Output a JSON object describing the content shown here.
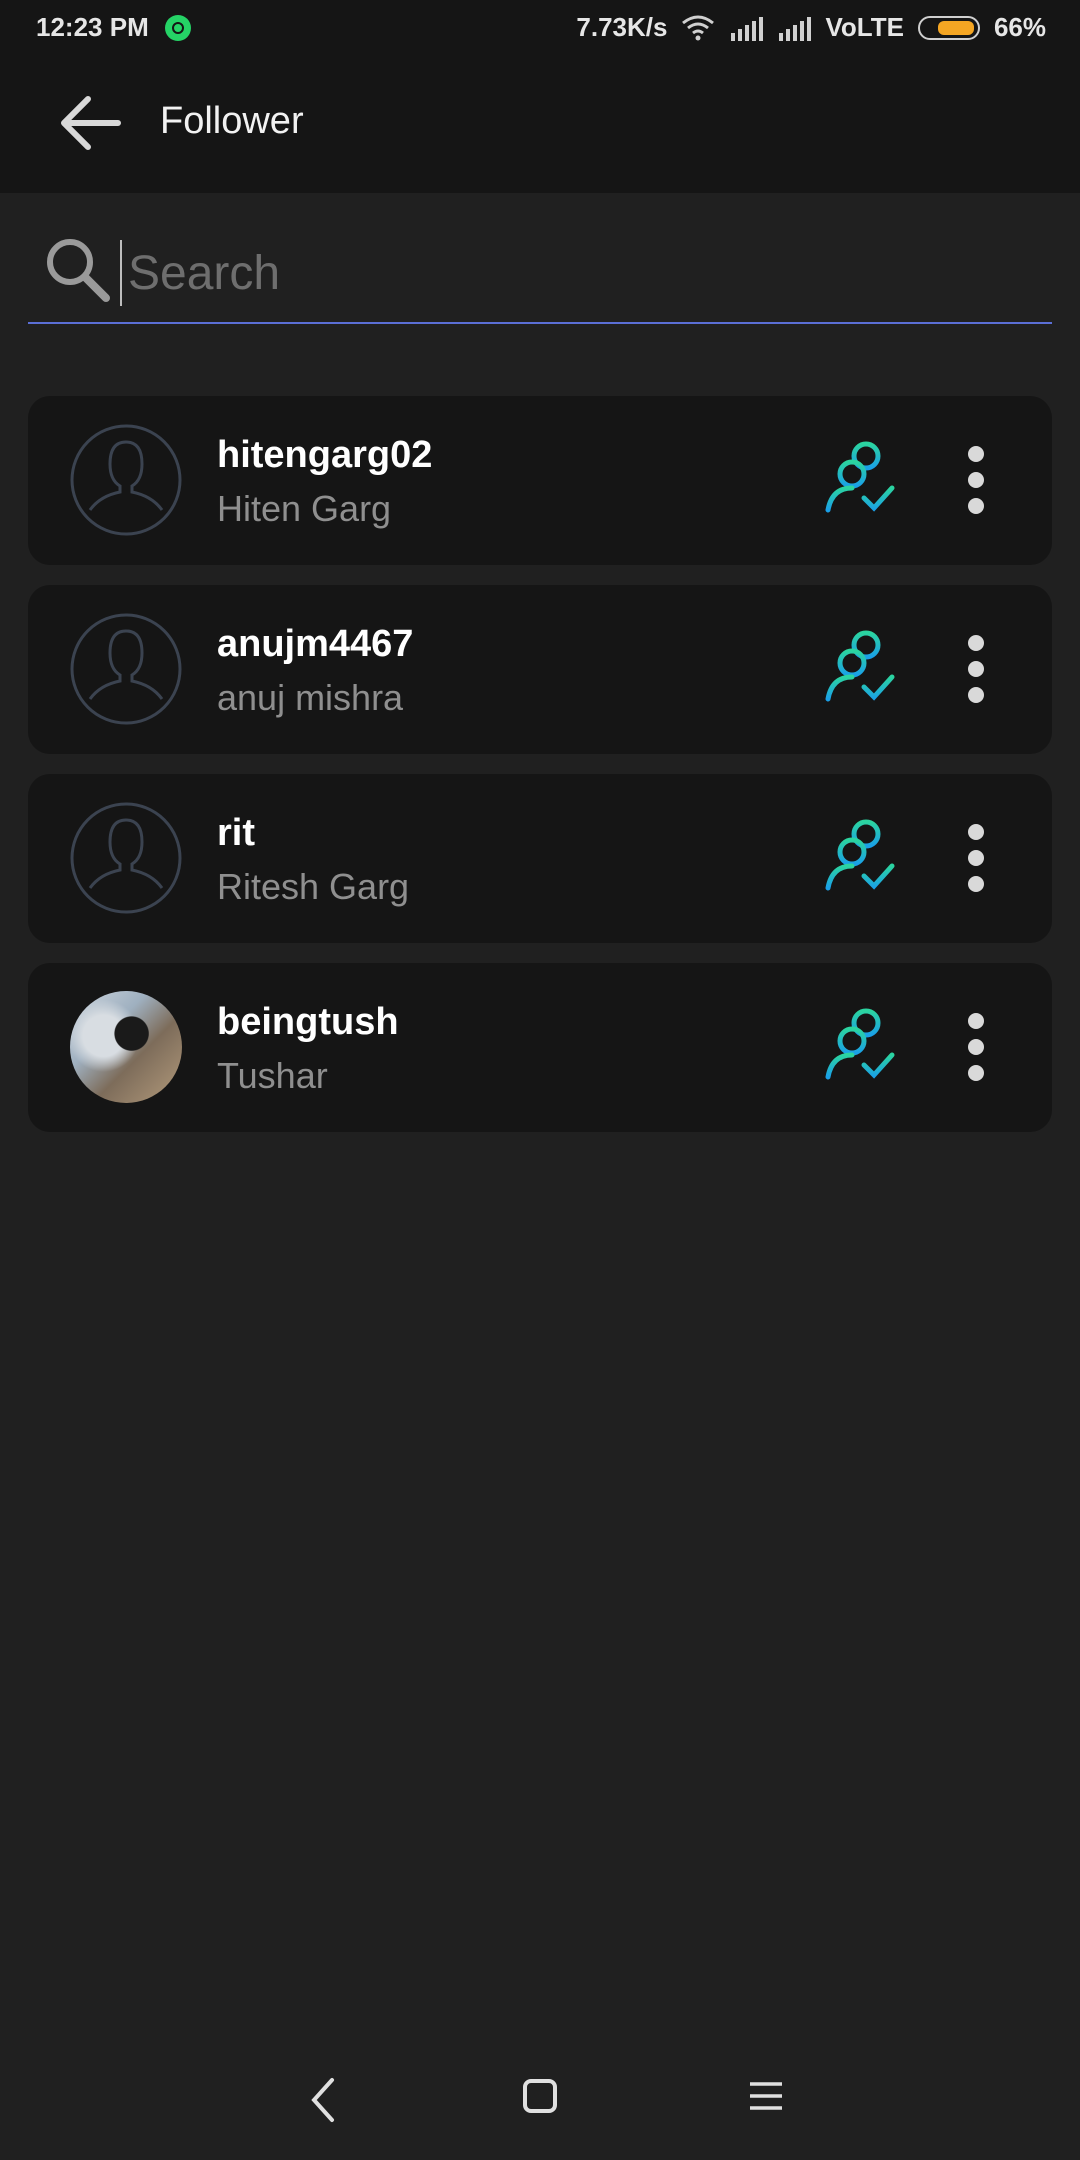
{
  "status_bar": {
    "time": "12:23 PM",
    "net_speed": "7.73K/s",
    "network": "VoLTE",
    "battery": "66%",
    "battery_level": 0.66,
    "icons": [
      "whatsapp-icon",
      "wifi-icon",
      "signal-icon",
      "signal-icon",
      "battery-icon"
    ]
  },
  "appbar": {
    "title": "Follower",
    "back_icon": "arrow-left-icon"
  },
  "search": {
    "placeholder": "Search",
    "value": "",
    "icon": "search-icon",
    "underline_color": "#5b6fd6"
  },
  "followers": [
    {
      "username": "hitengarg02",
      "name": "Hiten Garg",
      "avatar": "default-avatar-icon"
    },
    {
      "username": "anujm4467",
      "name": "anuj mishra",
      "avatar": "default-avatar-icon"
    },
    {
      "username": "rit",
      "name": "Ritesh Garg",
      "avatar": "default-avatar-icon"
    },
    {
      "username": "beingtush",
      "name": "Tushar",
      "avatar": "photo"
    }
  ],
  "row_actions": {
    "follow_status_icon": "following-check-icon",
    "more_icon": "more-vertical-icon"
  },
  "colors": {
    "background": "#202020",
    "card": "#151515",
    "follow_gradient_top": "#2bd4a0",
    "follow_gradient_bottom": "#1aa0e8"
  },
  "navbar": {
    "icons": [
      "nav-back-icon",
      "nav-home-icon",
      "nav-menu-icon"
    ]
  }
}
